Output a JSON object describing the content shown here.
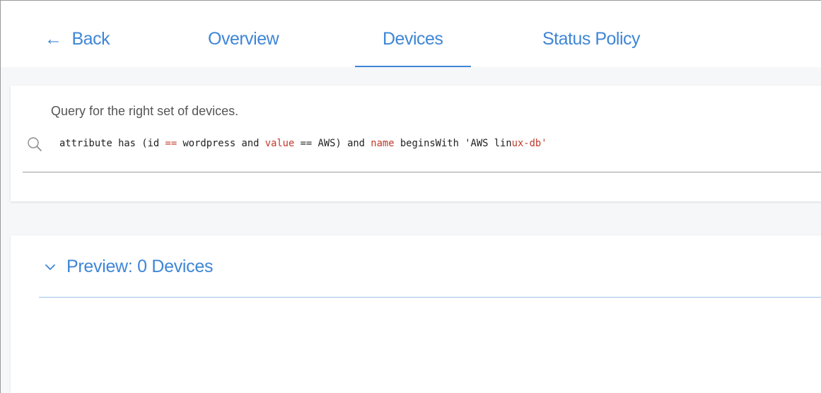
{
  "nav": {
    "back_label": "Back",
    "tabs": [
      {
        "label": "Overview"
      },
      {
        "label": "Devices",
        "active": true
      },
      {
        "label": "Status Policy"
      }
    ]
  },
  "query": {
    "title": "Query for the right set of devices.",
    "tokens": [
      {
        "text": "attribute has (id ",
        "highlight": false
      },
      {
        "text": "==",
        "highlight": true
      },
      {
        "text": " wordpress and ",
        "highlight": false
      },
      {
        "text": "value",
        "highlight": true
      },
      {
        "text": " == AWS) and ",
        "highlight": false
      },
      {
        "text": "name",
        "highlight": true
      },
      {
        "text": " beginsWith 'AWS lin",
        "highlight": false
      },
      {
        "text": "ux-db'",
        "highlight": true
      }
    ]
  },
  "preview": {
    "title": "Preview: 0 Devices",
    "expanded": true
  },
  "colors": {
    "accent": "#3f86d6",
    "keyword": "#c0392b",
    "page_bg": "#f6f7f9"
  }
}
